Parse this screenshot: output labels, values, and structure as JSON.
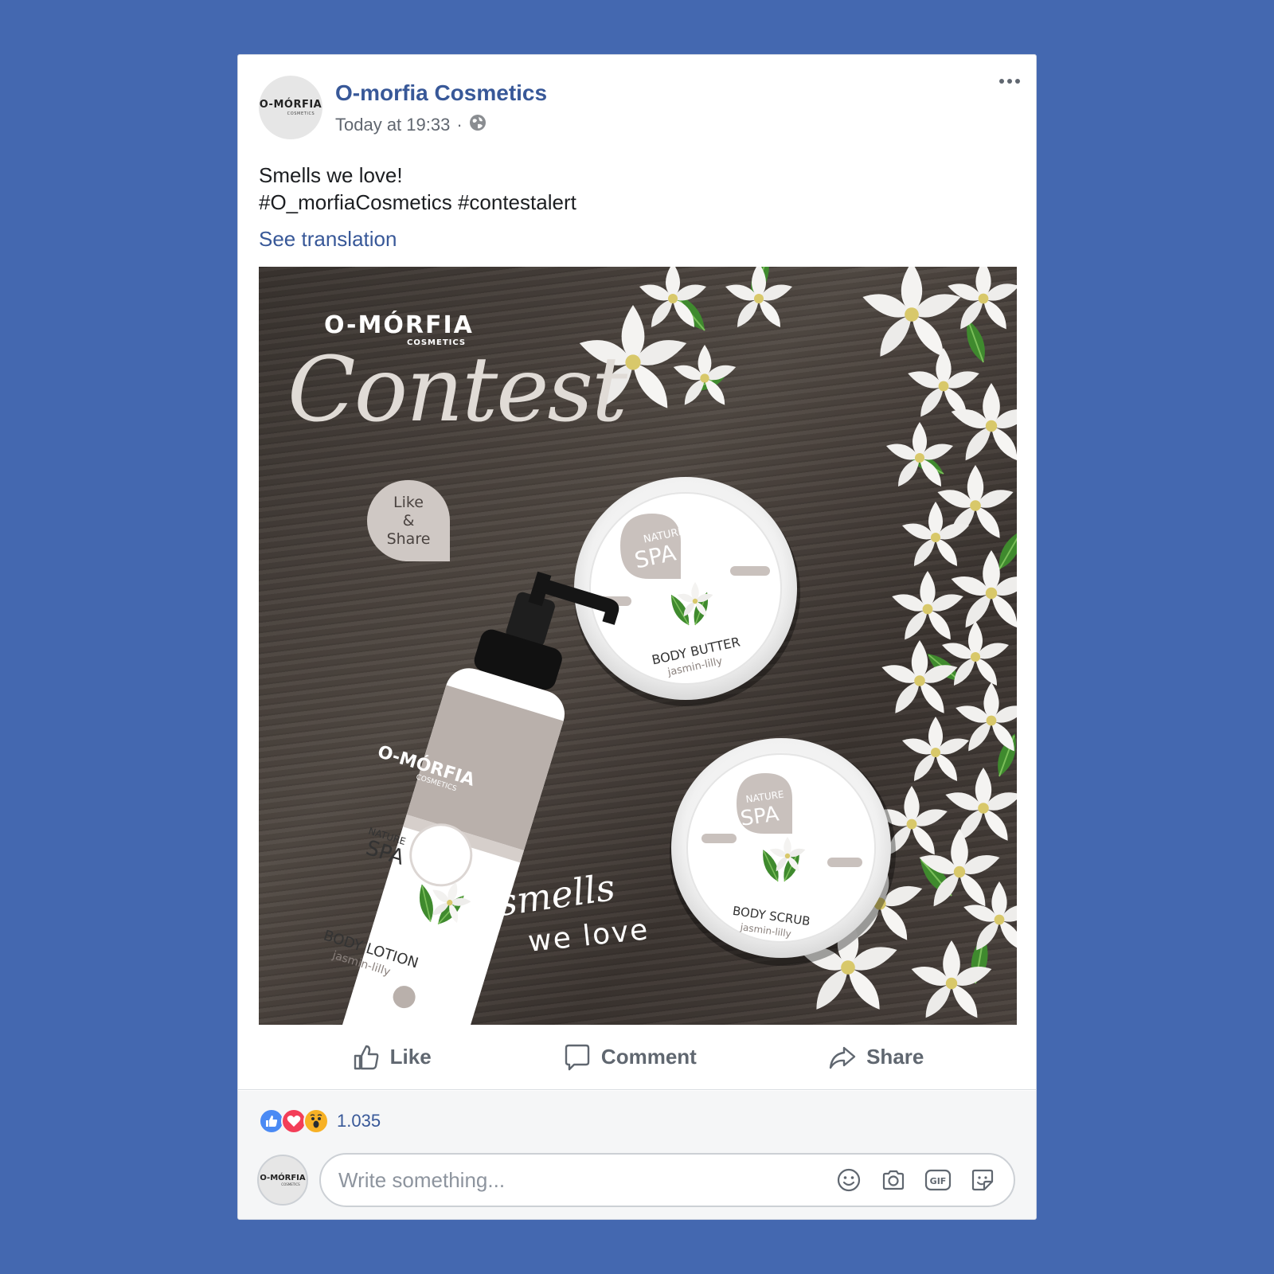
{
  "post": {
    "page_name": "O-morfia Cosmetics",
    "timestamp": "Today at 19:33",
    "separator": "·",
    "privacy_icon": "globe-icon",
    "text_line1": "Smells we love!",
    "text_line2": "#O_morfiaCosmetics #contestalert",
    "see_translation": "See translation",
    "avatar_logo": "O-MÓRFIA",
    "avatar_logo_sub": "COSMETICS"
  },
  "image": {
    "brand": "O-MÓRFIA",
    "brand_sub": "COSMETICS",
    "headline": "Contest",
    "badge_line1": "Like",
    "badge_line2": "&",
    "badge_line3": "Share",
    "tagline1": "smells",
    "tagline2": "we love",
    "products": [
      {
        "series": "NATURE",
        "line": "SPA",
        "name": "BODY BUTTER",
        "variant": "jasmin-lilly"
      },
      {
        "series": "NATURE",
        "line": "SPA",
        "name": "BODY SCRUB",
        "variant": "jasmin-lilly"
      },
      {
        "series": "NATURE",
        "line": "SPA",
        "name": "BODY LOTION",
        "variant": "jasmin-lilly",
        "brand": "O-MÓRFIA",
        "brand_sub": "COSMETICS"
      }
    ]
  },
  "actions": {
    "like": "Like",
    "comment": "Comment",
    "share": "Share"
  },
  "reactions": {
    "types": [
      "like",
      "love",
      "wow"
    ],
    "count": "1.035"
  },
  "comment": {
    "placeholder": "Write something...",
    "tools": [
      "emoji-icon",
      "camera-icon",
      "gif-icon",
      "sticker-icon"
    ]
  },
  "colors": {
    "background": "#4468b0",
    "link": "#385898",
    "like_reaction": "#4a8af4",
    "love_reaction": "#f33e58",
    "wow_reaction": "#f7b125"
  }
}
